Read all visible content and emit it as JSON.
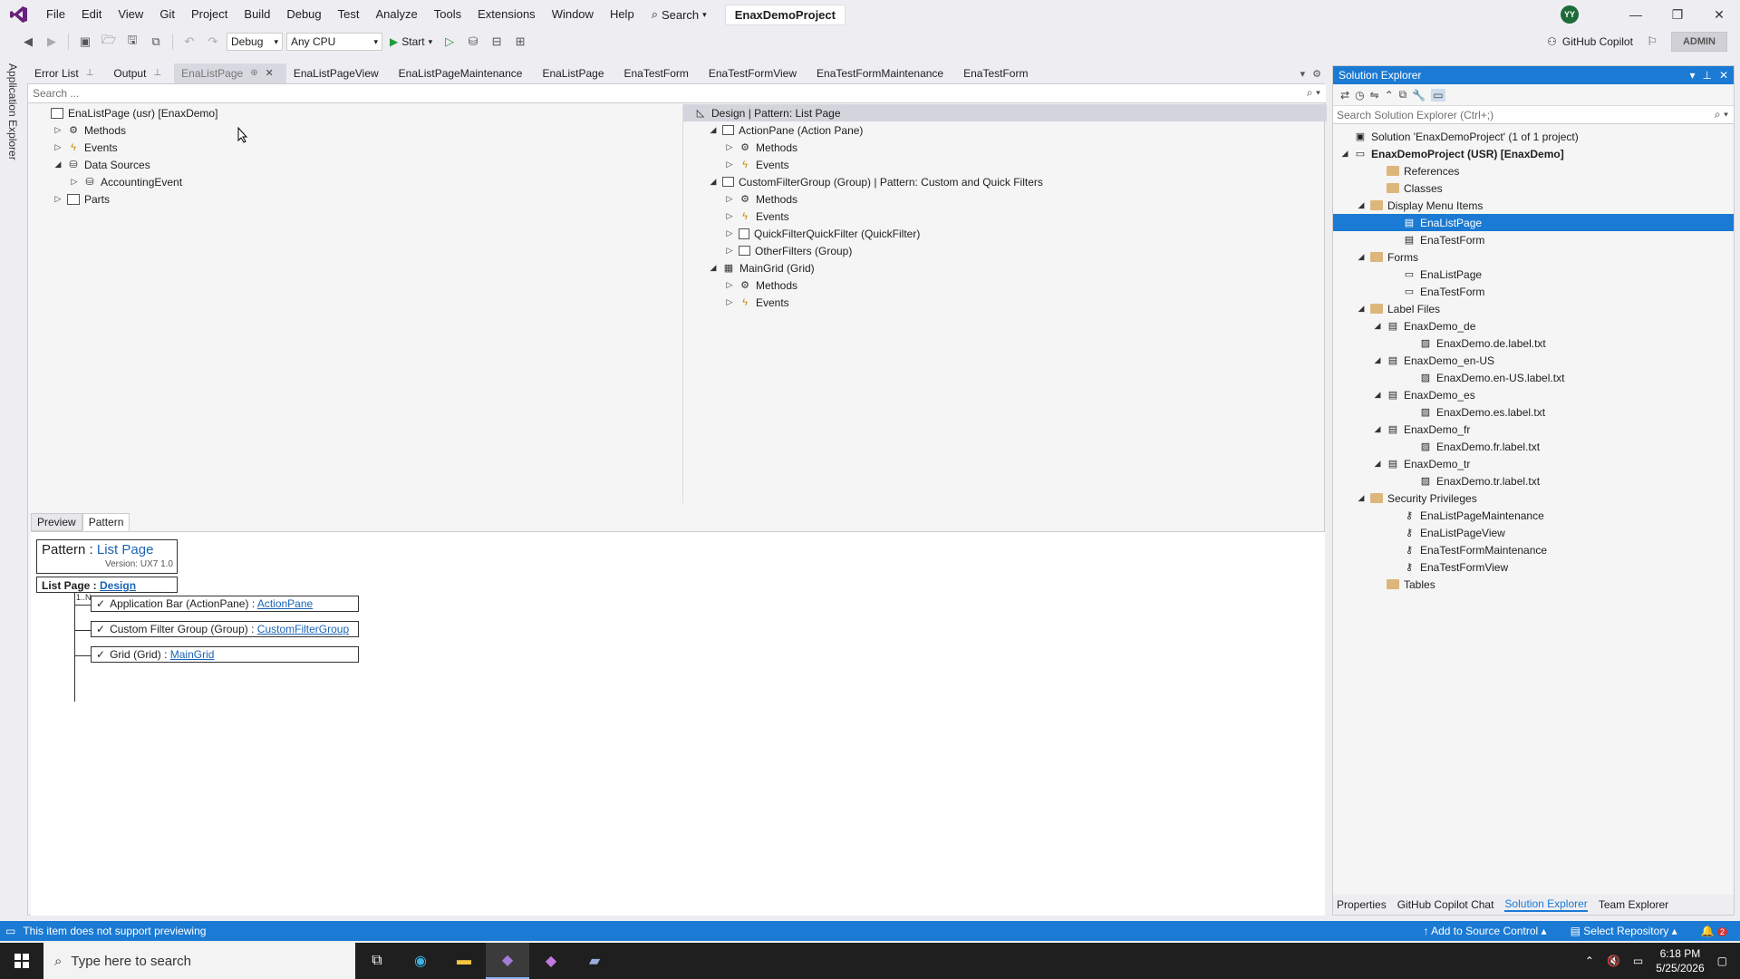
{
  "menu": {
    "items": [
      "File",
      "Edit",
      "View",
      "Git",
      "Project",
      "Build",
      "Debug",
      "Test",
      "Analyze",
      "Tools",
      "Extensions",
      "Window",
      "Help"
    ],
    "search_label": "Search",
    "project_title": "EnaxDemoProject",
    "avatar_initials": "YY"
  },
  "toolbar": {
    "config": "Debug",
    "platform": "Any CPU",
    "start_label": "Start",
    "copilot_label": "GitHub Copilot",
    "admin_label": "ADMIN"
  },
  "side": {
    "label": "Application Explorer"
  },
  "doc_tabs": [
    {
      "label": "Error List",
      "pin": "⊥"
    },
    {
      "label": "Output",
      "pin": "⊥"
    },
    {
      "label": "EnaListPage",
      "pin": "⊕",
      "active": true
    },
    {
      "label": "EnaListPageView"
    },
    {
      "label": "EnaListPageMaintenance"
    },
    {
      "label": "EnaListPage"
    },
    {
      "label": "EnaTestForm"
    },
    {
      "label": "EnaTestFormView"
    },
    {
      "label": "EnaTestFormMaintenance"
    },
    {
      "label": "EnaTestForm"
    }
  ],
  "editor": {
    "search_placeholder": "Search ...",
    "left_tree": [
      {
        "label": "EnaListPage (usr) [EnaxDemo]",
        "icon": "form",
        "level": 0,
        "expander": ""
      },
      {
        "label": "Methods",
        "icon": "methods",
        "level": 1,
        "expander": "▷"
      },
      {
        "label": "Events",
        "icon": "events",
        "level": 1,
        "expander": "▷"
      },
      {
        "label": "Data Sources",
        "icon": "db",
        "level": 1,
        "expander": "◢"
      },
      {
        "label": "AccountingEvent",
        "icon": "db",
        "level": 2,
        "expander": "▷"
      },
      {
        "label": "Parts",
        "icon": "form",
        "level": 1,
        "expander": "▷"
      }
    ],
    "right_tree": [
      {
        "label": "Design | Pattern: List Page",
        "icon": "design",
        "level": 0,
        "expander": "",
        "header": true
      },
      {
        "label": "ActionPane (Action Pane)",
        "icon": "group",
        "level": 1,
        "expander": "◢"
      },
      {
        "label": "Methods",
        "icon": "methods",
        "level": 2,
        "expander": "▷"
      },
      {
        "label": "Events",
        "icon": "events",
        "level": 2,
        "expander": "▷"
      },
      {
        "label": "CustomFilterGroup (Group) | Pattern: Custom and Quick Filters",
        "icon": "group",
        "level": 1,
        "expander": "◢"
      },
      {
        "label": "Methods",
        "icon": "methods",
        "level": 2,
        "expander": "▷"
      },
      {
        "label": "Events",
        "icon": "events",
        "level": 2,
        "expander": "▷"
      },
      {
        "label": "QuickFilterQuickFilter (QuickFilter)",
        "icon": "check",
        "level": 2,
        "expander": "▷"
      },
      {
        "label": "OtherFilters (Group)",
        "icon": "group",
        "level": 2,
        "expander": "▷"
      },
      {
        "label": "MainGrid (Grid)",
        "icon": "grid",
        "level": 1,
        "expander": "◢"
      },
      {
        "label": "Methods",
        "icon": "methods",
        "level": 2,
        "expander": "▷"
      },
      {
        "label": "Events",
        "icon": "events",
        "level": 2,
        "expander": "▷"
      }
    ]
  },
  "pattern_pane": {
    "tabs": [
      "Preview",
      "Pattern"
    ],
    "pattern_prefix": "Pattern : ",
    "pattern_name": "List Page",
    "version": "Version: UX7 1.0",
    "root_prefix": "List Page : ",
    "root_link": "Design",
    "cardinality": "1..N",
    "children": [
      {
        "check": "✓",
        "label": "Application Bar  (ActionPane)  : ",
        "link": "ActionPane"
      },
      {
        "check": "✓",
        "label": "Custom Filter Group  (Group)  : ",
        "link": "CustomFilterGroup"
      },
      {
        "check": "✓",
        "label": "Grid  (Grid)  : ",
        "link": "MainGrid"
      }
    ]
  },
  "solution_explorer": {
    "title": "Solution Explorer",
    "search_placeholder": "Search Solution Explorer (Ctrl+;)",
    "items": [
      {
        "label": "Solution 'EnaxDemoProject' (1 of 1 project)",
        "icon": "solution",
        "level": 0,
        "expander": ""
      },
      {
        "label": "EnaxDemoProject (USR) [EnaxDemo]",
        "icon": "project",
        "level": 0,
        "expander": "◢",
        "bold": true
      },
      {
        "label": "References",
        "icon": "folder",
        "level": 2,
        "expander": ""
      },
      {
        "label": "Classes",
        "icon": "folder",
        "level": 2,
        "expander": ""
      },
      {
        "label": "Display Menu Items",
        "icon": "folder",
        "level": 1,
        "expander": "◢"
      },
      {
        "label": "EnaListPage",
        "icon": "menuitem",
        "level": 3,
        "expander": "",
        "selected": true
      },
      {
        "label": "EnaTestForm",
        "icon": "menuitem",
        "level": 3,
        "expander": ""
      },
      {
        "label": "Forms",
        "icon": "folder",
        "level": 1,
        "expander": "◢"
      },
      {
        "label": "EnaListPage",
        "icon": "form",
        "level": 3,
        "expander": ""
      },
      {
        "label": "EnaTestForm",
        "icon": "form",
        "level": 3,
        "expander": ""
      },
      {
        "label": "Label Files",
        "icon": "folder",
        "level": 1,
        "expander": "◢"
      },
      {
        "label": "EnaxDemo_de",
        "icon": "label",
        "level": 2,
        "expander": "◢"
      },
      {
        "label": "EnaxDemo.de.label.txt",
        "icon": "txt",
        "level": 4,
        "expander": ""
      },
      {
        "label": "EnaxDemo_en-US",
        "icon": "label",
        "level": 2,
        "expander": "◢"
      },
      {
        "label": "EnaxDemo.en-US.label.txt",
        "icon": "txt",
        "level": 4,
        "expander": ""
      },
      {
        "label": "EnaxDemo_es",
        "icon": "label",
        "level": 2,
        "expander": "◢"
      },
      {
        "label": "EnaxDemo.es.label.txt",
        "icon": "txt",
        "level": 4,
        "expander": ""
      },
      {
        "label": "EnaxDemo_fr",
        "icon": "label",
        "level": 2,
        "expander": "◢"
      },
      {
        "label": "EnaxDemo.fr.label.txt",
        "icon": "txt",
        "level": 4,
        "expander": ""
      },
      {
        "label": "EnaxDemo_tr",
        "icon": "label",
        "level": 2,
        "expander": "◢"
      },
      {
        "label": "EnaxDemo.tr.label.txt",
        "icon": "txt",
        "level": 4,
        "expander": ""
      },
      {
        "label": "Security Privileges",
        "icon": "folder",
        "level": 1,
        "expander": "◢"
      },
      {
        "label": "EnaListPageMaintenance",
        "icon": "key",
        "level": 3,
        "expander": ""
      },
      {
        "label": "EnaListPageView",
        "icon": "key",
        "level": 3,
        "expander": ""
      },
      {
        "label": "EnaTestFormMaintenance",
        "icon": "key",
        "level": 3,
        "expander": ""
      },
      {
        "label": "EnaTestFormView",
        "icon": "key",
        "level": 3,
        "expander": ""
      },
      {
        "label": "Tables",
        "icon": "folder",
        "level": 2,
        "expander": ""
      }
    ],
    "bottom_tabs": [
      "Properties",
      "GitHub Copilot Chat",
      "Solution Explorer",
      "Team Explorer"
    ],
    "active_bottom_tab": "Solution Explorer"
  },
  "status": {
    "message": "This item does not support previewing",
    "source_control": "Add to Source Control",
    "repository": "Select Repository",
    "notifications": "2"
  },
  "taskbar": {
    "search_placeholder": "Type here to search",
    "time": "6:18 PM",
    "date": "5/25/2026"
  },
  "colors": {
    "accent": "#1b7ad3",
    "chrome": "#eeeef2",
    "taskbar": "#1f1f1f"
  }
}
